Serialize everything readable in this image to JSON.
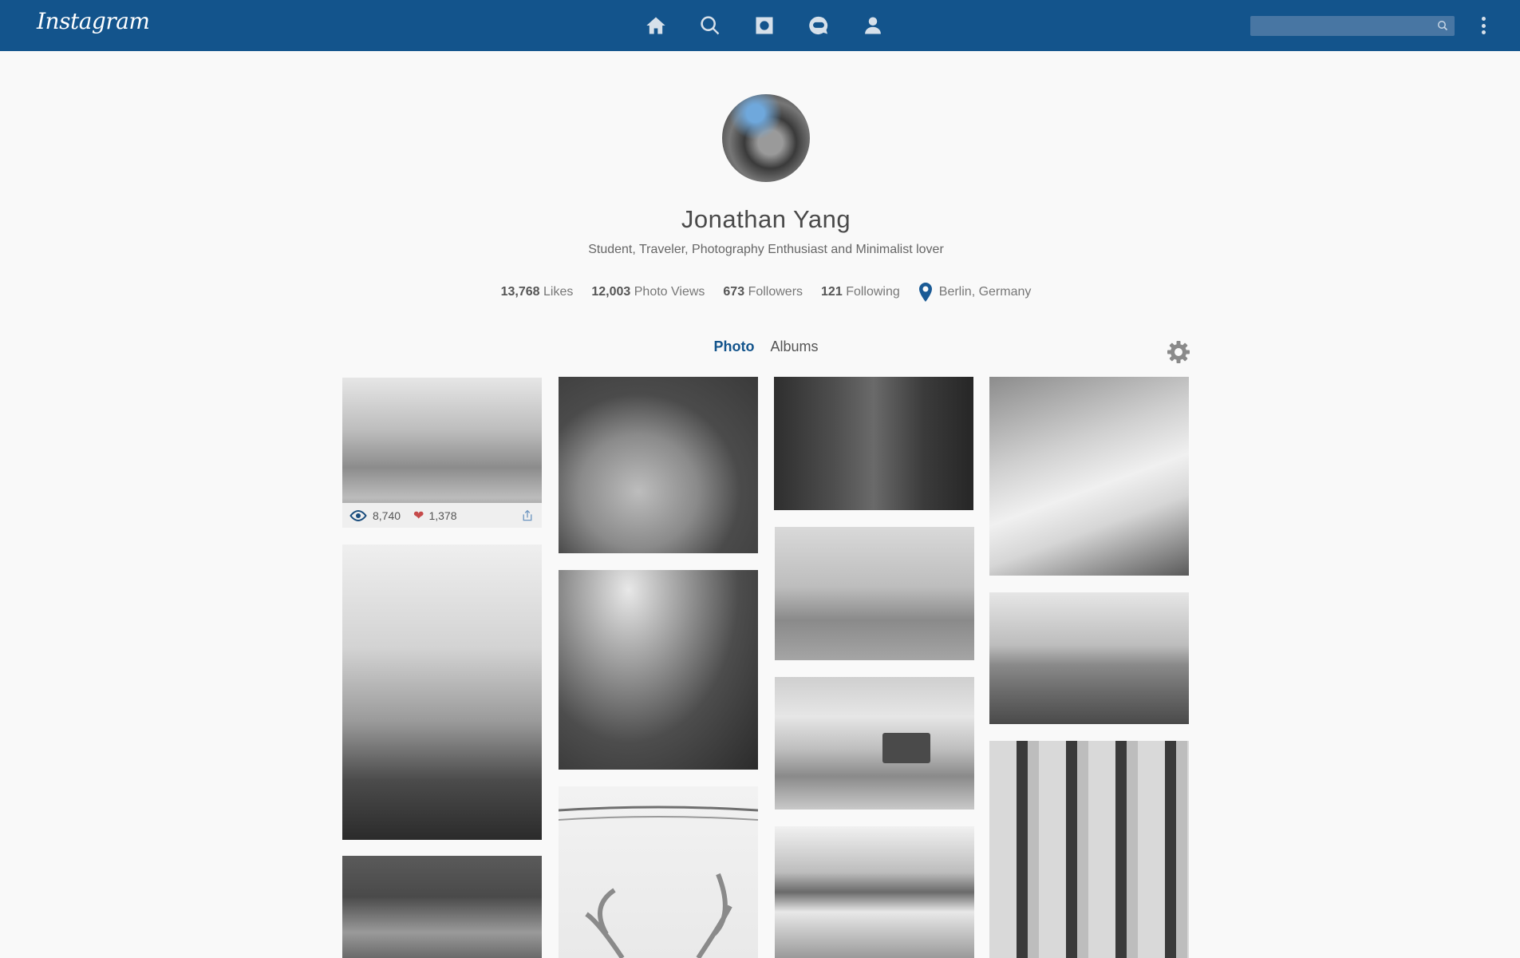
{
  "app": {
    "logo": "Instagram"
  },
  "topbar": {
    "nav": [
      {
        "name": "home-icon"
      },
      {
        "name": "search-icon"
      },
      {
        "name": "camera-icon"
      },
      {
        "name": "messages-icon"
      },
      {
        "name": "profile-icon"
      }
    ],
    "search_placeholder": "",
    "accent": "#13548c"
  },
  "profile": {
    "name": "Jonathan Yang",
    "bio": "Student, Traveler, Photography Enthusiast and Minimalist lover",
    "stats": [
      {
        "value": "13,768",
        "label": "Likes"
      },
      {
        "value": "12,003",
        "label": "Photo Views"
      },
      {
        "value": "673",
        "label": "Followers"
      },
      {
        "value": "121",
        "label": "Following"
      }
    ],
    "location": "Berlin, Germany"
  },
  "tabs": [
    {
      "label": "Photo",
      "active": true
    },
    {
      "label": "Albums",
      "active": false
    }
  ],
  "photos": {
    "first_views": "8,740",
    "first_likes": "1,378"
  }
}
